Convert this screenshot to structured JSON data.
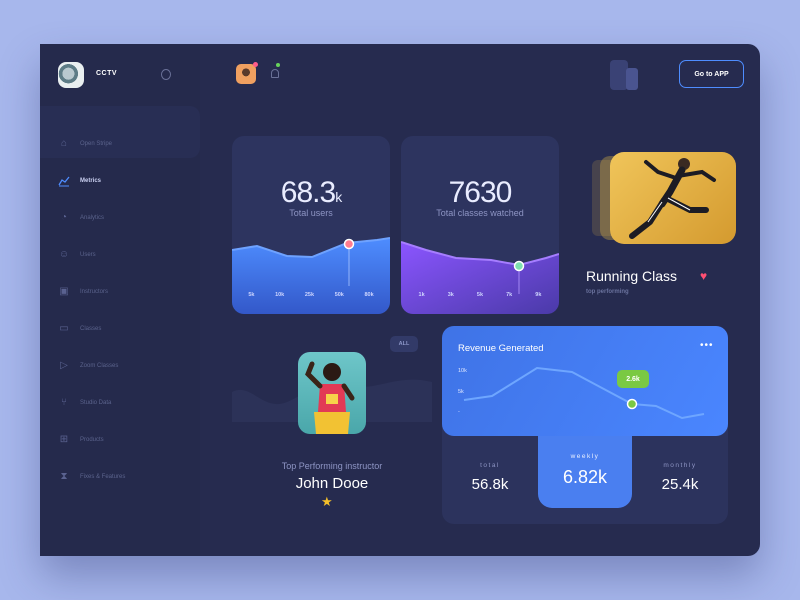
{
  "app": {
    "brand": "CCTV"
  },
  "sidebar": {
    "items": [
      {
        "label": "Open Stripe",
        "icon": "home-icon",
        "active": false
      },
      {
        "label": "Metrics",
        "icon": "line-chart-icon",
        "active": true
      },
      {
        "label": "Analytics",
        "icon": "pie-chart-icon",
        "active": false
      },
      {
        "label": "Users",
        "icon": "users-icon",
        "active": false
      },
      {
        "label": "Instructors",
        "icon": "badge-icon",
        "active": false
      },
      {
        "label": "Classes",
        "icon": "tv-icon",
        "active": false
      },
      {
        "label": "Zoom Classes",
        "icon": "video-icon",
        "active": false
      },
      {
        "label": "Studio Data",
        "icon": "branch-icon",
        "active": false
      },
      {
        "label": "Products",
        "icon": "gift-icon",
        "active": false
      },
      {
        "label": "Fixes & Features",
        "icon": "hourglass-icon",
        "active": false
      }
    ]
  },
  "header": {
    "go_to_app": "Go to APP"
  },
  "users_card": {
    "value": "68.3",
    "unit": "k",
    "label": "Total users",
    "ticks": [
      "5k",
      "10k",
      "25k",
      "50k",
      "80k"
    ]
  },
  "classes_card": {
    "value": "7630",
    "label": "Total classes watched",
    "ticks": [
      "1k",
      "3k",
      "5k",
      "7k",
      "9k"
    ]
  },
  "running": {
    "title": "Running Class",
    "subtitle": "top performing"
  },
  "instructor": {
    "filter": "ALL",
    "subtitle": "Top Performing instructor",
    "name": "John Dooe"
  },
  "revenue": {
    "title": "Revenue Generated",
    "y_labels": [
      "10k",
      "5k",
      "-"
    ],
    "tooltip": "2.6k",
    "total_label": "total",
    "total_value": "56.8k",
    "weekly_label": "weekly",
    "weekly_value": "6.82k",
    "monthly_label": "monthly",
    "monthly_value": "25.4k"
  },
  "colors": {
    "accent": "#4e8dff",
    "purple": "#7c4dff",
    "heart": "#ff4f72",
    "tooltip": "#7ac943"
  }
}
